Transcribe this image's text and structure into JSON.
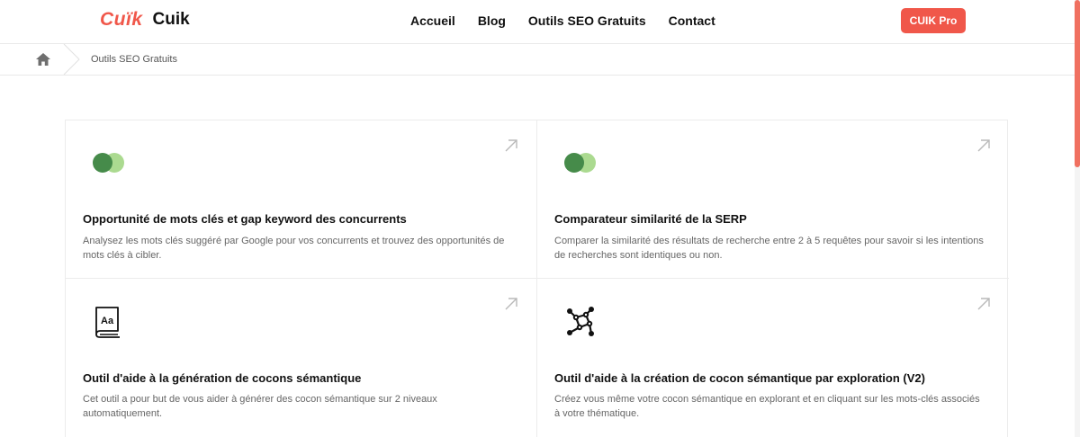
{
  "header": {
    "logo_mark": "Cuïk",
    "logo_text": "Cuik",
    "nav": [
      "Accueil",
      "Blog",
      "Outils SEO Gratuits",
      "Contact"
    ],
    "pro_button": "CUIK Pro"
  },
  "breadcrumb": {
    "current": "Outils SEO Gratuits"
  },
  "colors": {
    "accent": "#f0574a",
    "circle_dark": "#468b4a",
    "circle_light": "#a7d88a"
  },
  "cards": [
    {
      "icon": "overlap-circles-icon",
      "title": "Opportunité de mots clés et gap keyword des concurrents",
      "desc": "Analysez les mots clés suggéré par Google pour vos concurrents et trouvez des opportunités de mots clés à cibler."
    },
    {
      "icon": "overlap-circles-icon",
      "title": "Comparateur similarité de la SERP",
      "desc": "Comparer la similarité des résultats de recherche entre 2 à 5 requêtes pour savoir si les intentions de recherches sont identiques ou non."
    },
    {
      "icon": "dictionary-book-icon",
      "title": "Outil d'aide à la génération de cocons sémantique",
      "desc": "Cet outil a pour but de vous aider à générer des cocon sémantique sur 2 niveaux automatiquement."
    },
    {
      "icon": "network-nodes-icon",
      "title": "Outil d'aide à la création de cocon sémantique par exploration (V2)",
      "desc": "Créez vous même votre cocon sémantique en explorant et en cliquant sur les mots-clés associés à votre thématique."
    }
  ]
}
